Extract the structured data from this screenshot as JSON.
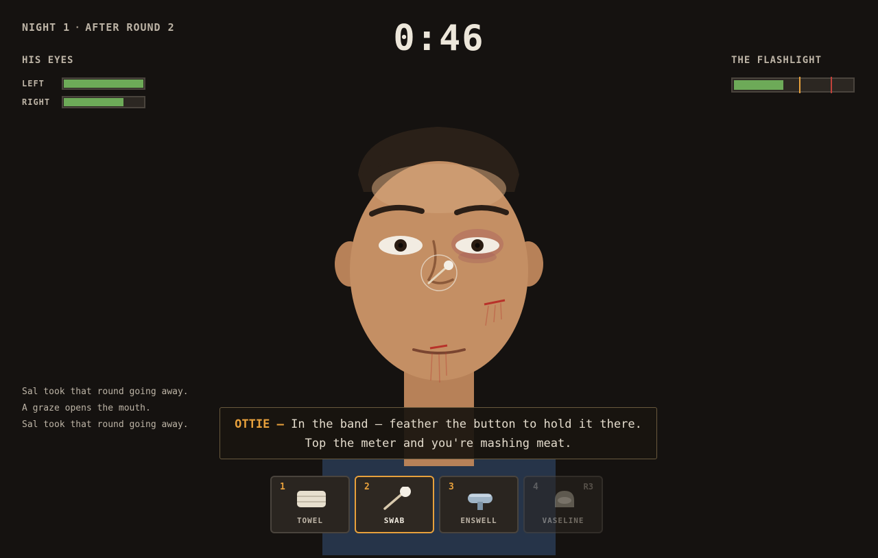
{
  "hud": {
    "night": "NIGHT 1",
    "separator": "·",
    "round": "AFTER ROUND 2"
  },
  "timer": "0:46",
  "eyes": {
    "label": "HIS EYES",
    "left": {
      "label": "LEFT",
      "level": 1.0
    },
    "right": {
      "label": "RIGHT",
      "level": 0.75
    }
  },
  "flashlight": {
    "label": "THE FLASHLIGHT",
    "level": 0.42,
    "markers": [
      {
        "position": 0.55,
        "color": "#e8a13c"
      },
      {
        "position": 0.82,
        "color": "#c2413a"
      }
    ]
  },
  "log": [
    "Sal took that round going away.",
    "A graze opens the mouth.",
    "Sal took that round going away."
  ],
  "dialog": {
    "speaker": "OTTIE —",
    "text": "In the band — feather the button to hold it there. Top the meter and you're mashing meat."
  },
  "tools": [
    {
      "key": "1",
      "name": "TOWEL",
      "icon": "towel-icon",
      "uses": ""
    },
    {
      "key": "2",
      "name": "SWAB",
      "icon": "swab-icon",
      "uses": ""
    },
    {
      "key": "3",
      "name": "ENSWELL",
      "icon": "enswell-icon",
      "uses": ""
    },
    {
      "key": "4",
      "name": "VASELINE",
      "icon": "vaseline-icon",
      "uses": "R3"
    }
  ],
  "colors": {
    "accent": "#e8a13c",
    "health": "#6daa58",
    "danger": "#c2413a",
    "skin": "#c48f64",
    "blood": "#b8322a"
  }
}
